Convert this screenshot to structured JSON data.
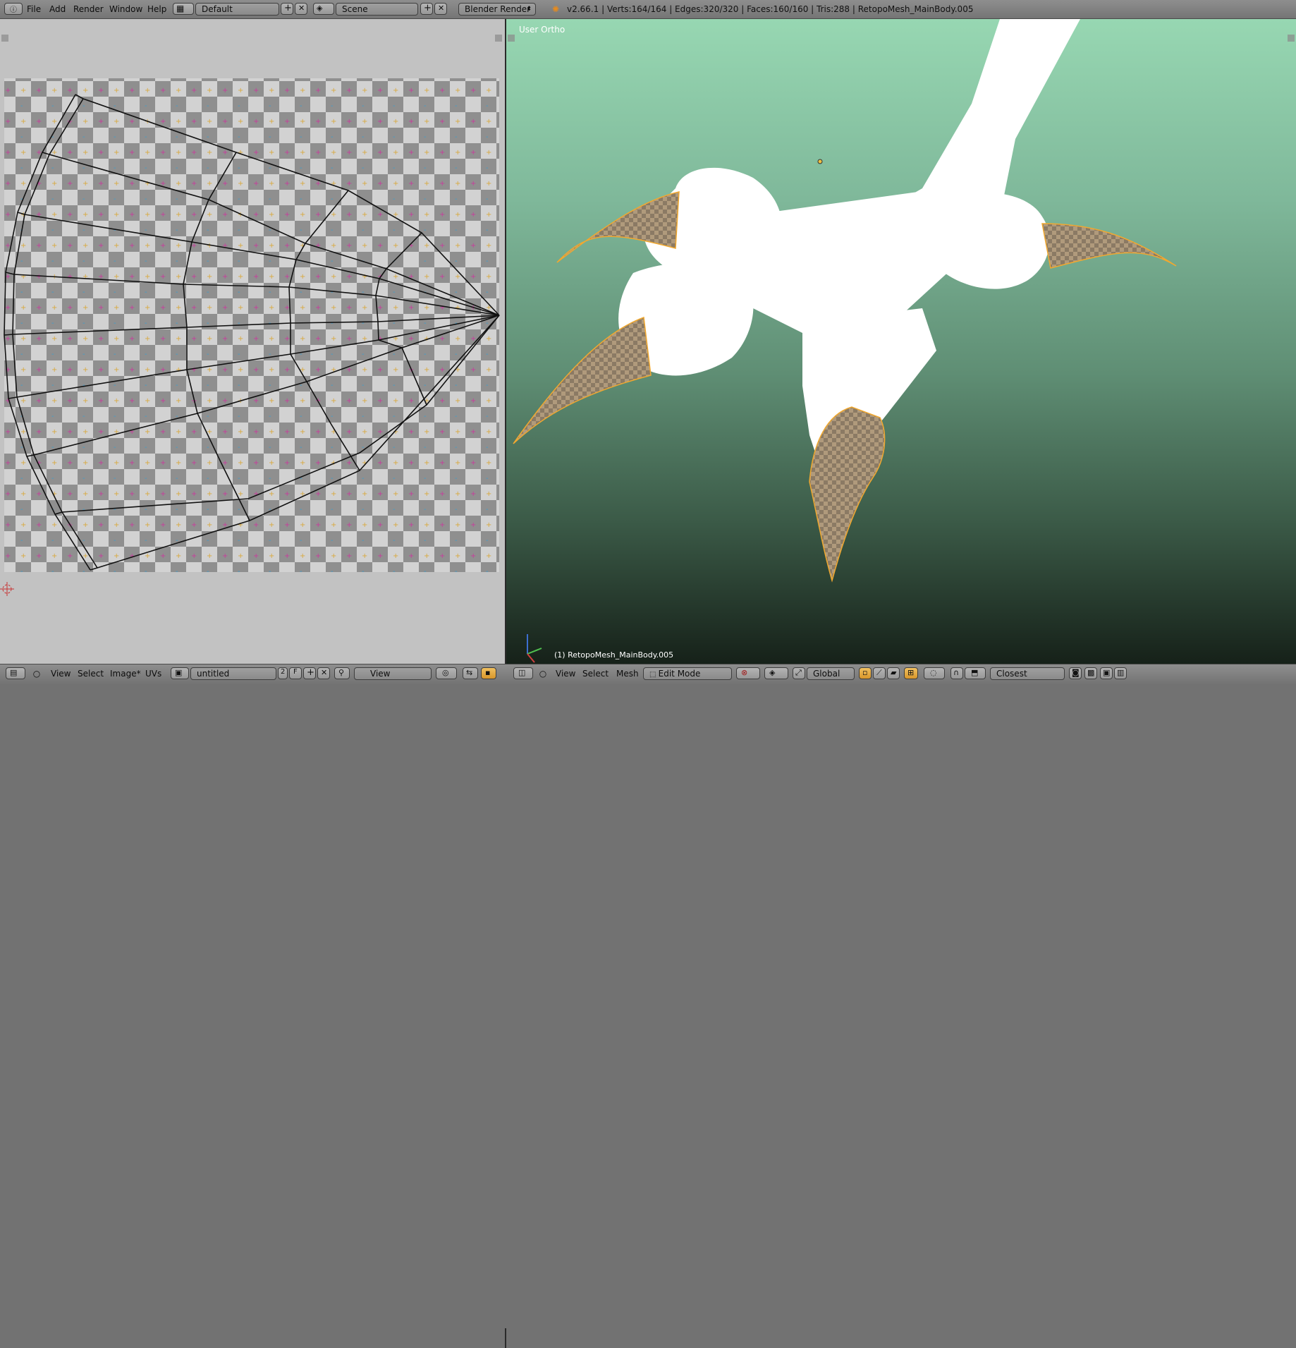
{
  "colors": {
    "header_bg": "#8a8a8a",
    "uv_bg": "#c2c2c2",
    "viewport_top": "#97d7b2",
    "viewport_bottom": "#162119",
    "selected_wire": "#f0a830",
    "mesh_white": "#ffffff"
  },
  "top_header": {
    "menus": [
      "File",
      "Add",
      "Render",
      "Window",
      "Help"
    ],
    "screen_layout": "Default",
    "scene": "Scene",
    "render_engine": "Blender Render",
    "stats": "v2.66.1 | Verts:164/164 | Edges:320/320 | Faces:160/160 | Tris:288 | RetopoMesh_MainBody.005"
  },
  "viewport": {
    "view_name": "User Ortho",
    "object_label": "(1) RetopoMesh_MainBody.005"
  },
  "uv_header": {
    "menus": [
      "View",
      "Select",
      "Image*",
      "UVs"
    ],
    "image_name": "untitled",
    "users": "2",
    "fake_user": "F",
    "display_channel": "View"
  },
  "view3d_header": {
    "menus": [
      "View",
      "Select",
      "Mesh"
    ],
    "mode": "Edit Mode",
    "orientation": "Global",
    "snap_target": "Closest"
  }
}
